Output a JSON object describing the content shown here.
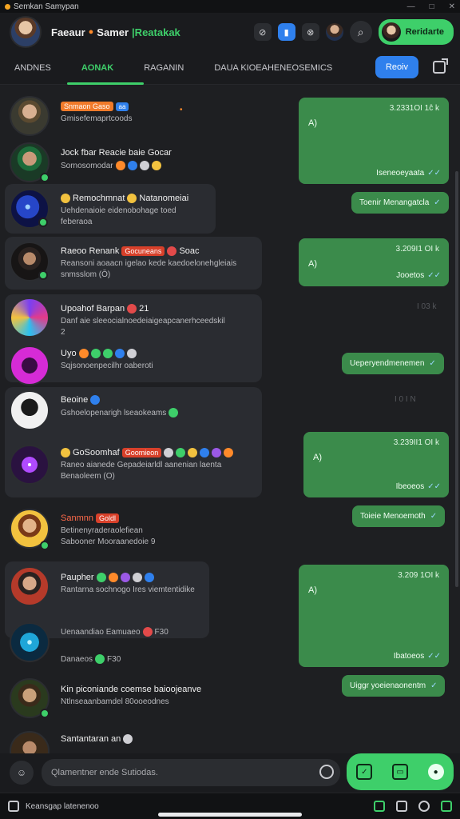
{
  "window": {
    "title": "Semkan Samypan"
  },
  "header": {
    "title_part1": "Faeaur",
    "title_part2": "Samer",
    "title_highlight": "|Reatakak",
    "profile_button": "Reridarte"
  },
  "tabs": {
    "items": [
      "ANDNES",
      "AONAK",
      "RAGANIN",
      "DAUA   KIOEAHENEOSEMICS"
    ],
    "active_index": 1,
    "cta": "Reoiv"
  },
  "messages": [
    {
      "name": "Snmaon Gaso",
      "badge": "aa",
      "preview": "Gmisefemaprtcoods"
    },
    {
      "name": "Jock fbar Reacie baie Gocar",
      "preview": "Sornosomodar"
    },
    {
      "name": "Remochmnat",
      "name_suffix": "Natanomeiai",
      "preview": "Uehdenaioie eidenobohage toed",
      "preview2": "feberaoa"
    },
    {
      "name": "Raeoo Renank",
      "badge": "Gocuneans",
      "name_suffix": "Soac",
      "preview": "Reansoni aoaacn igelao kede kaedoelonehgleiais",
      "preview2": "snmsslom (Ŏ)"
    },
    {
      "name": "Upoahof Barpan",
      "name_suffix": "21",
      "preview": "Danf aie sleeocialnoedeiaigeapcanerhceedskil",
      "preview2": "2"
    },
    {
      "name": "Uyo",
      "preview": "Sqjsonoenpecilhr oaberoti"
    },
    {
      "name": "Beoine",
      "preview": "Gshoelopenarigh lseaokeams"
    },
    {
      "name": "GoSoomhaf",
      "badge": "Goomieon",
      "preview": "Raneo aianede Gepadeiarldl aanenian laenta",
      "preview2": "Benaoleem (O)"
    },
    {
      "name": "Sanmnn",
      "badge": "Goldl",
      "preview": "Betinenyraderaolefiean",
      "preview2": "Sabooner Mooraanedoie 9"
    },
    {
      "name": "Paupher",
      "preview": "Rantarna sochnogo Ires viemtentidike"
    },
    {
      "name": "Uenaandiao Eamuaeo",
      "name_suffix": "F30"
    },
    {
      "name": "Danaeos",
      "name_suffix": "F30"
    },
    {
      "name": "Kin piconiande coemse baioojeanve",
      "preview": "Ntlnseaanbamdel 80ooeodnes"
    },
    {
      "name": "Santantaran an"
    }
  ],
  "bubbles": [
    {
      "time": "3.2331OI 1ĉ k",
      "body": "A)",
      "footer": "Iseneoeyaata"
    },
    {
      "label": "Toenir Menangatcla"
    },
    {
      "time": "3.209I1 OI k",
      "body": "A)",
      "footer": "Jooetos"
    },
    {
      "label": "Ueperyendmenemen"
    },
    {
      "time": "3.239II1 OI k",
      "body": "A)",
      "footer": "Ibeoeos"
    },
    {
      "label": "Toieie Menoemoth"
    },
    {
      "time": "3.209 1OI k",
      "body": "A)",
      "footer": "Ibatoeos"
    },
    {
      "label": "Uiggr yoeienaonentm"
    }
  ],
  "ghost_times": [
    "I 03 k",
    "I 0 I N"
  ],
  "composer": {
    "placeholder": "Qlamentner ende Sutiodas."
  },
  "footer": {
    "label": "Keansgap latenenoo"
  }
}
